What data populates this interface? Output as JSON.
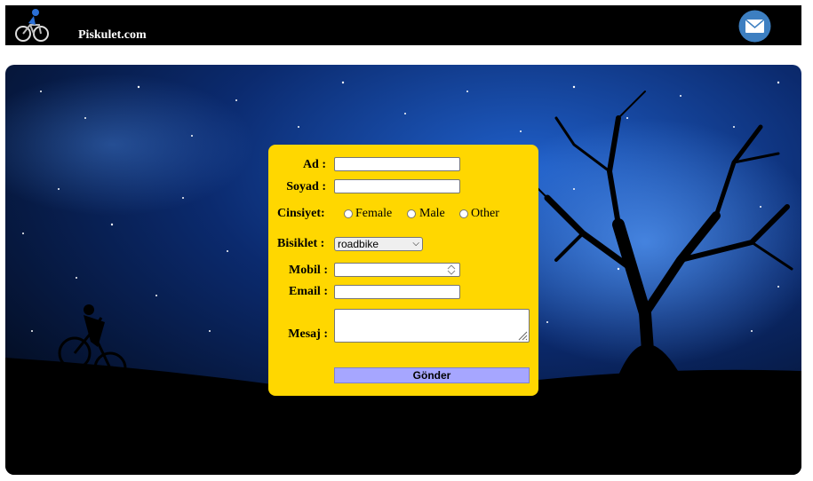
{
  "header": {
    "brand": "Piskulet.com",
    "logo_icon": "cyclist-icon",
    "mail_icon": "envelope-icon"
  },
  "form": {
    "ad_label": "Ad :",
    "soyad_label": "Soyad :",
    "cinsiyet_label": "Cinsiyet:",
    "gender_options": [
      "Female",
      "Male",
      "Other"
    ],
    "bisiklet_label": "Bisiklet :",
    "bisiklet_value": "roadbike",
    "mobil_label": "Mobil :",
    "email_label": "Email :",
    "mesaj_label": "Mesaj :",
    "submit_label": "Gönder"
  },
  "colors": {
    "form_bg": "#ffd700",
    "submit_bg": "#a6a6ff",
    "header_bg": "#000000"
  }
}
